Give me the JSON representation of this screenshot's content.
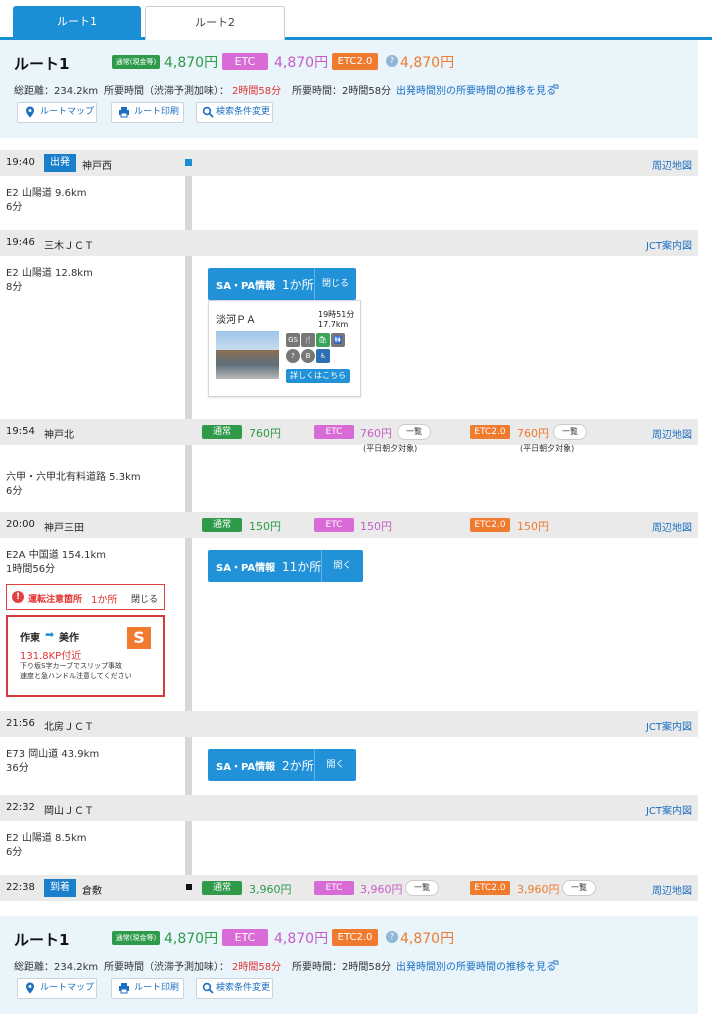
{
  "tabs": [
    {
      "label": "ルート1"
    },
    {
      "label": "ルート2"
    }
  ],
  "summary": {
    "title": "ルート1",
    "normal_badge": "通常(現金等)",
    "normal_price": "4,870円",
    "etc_badge": "ETC",
    "etc_price": "4,870円",
    "etc2_badge": "ETC2.0",
    "etc2_price": "4,870円",
    "info_icon": "?",
    "distance": "総距離：234.2km",
    "time_predicted_label": "所要時間（渋滞予測加味）：",
    "time_predicted": "2時間58分",
    "time_label": "所要時間：2時間58分",
    "trend_link": "出発時間別の所要時間の推移を見る",
    "buttons": {
      "map": "ルートマップ",
      "print": "ルート印刷",
      "search": "検索条件変更"
    }
  },
  "points": [
    {
      "time": "19:40",
      "name": "神戸西",
      "flag": "出発",
      "link": "周辺地図"
    },
    {
      "time": "19:46",
      "name": "三木ＪＣＴ",
      "link": "JCT案内図"
    },
    {
      "time": "19:54",
      "name": "神戸北",
      "link": "周辺地図"
    },
    {
      "time": "20:00",
      "name": "神戸三田",
      "link": "周辺地図"
    },
    {
      "time": "21:56",
      "name": "北房ＪＣＴ",
      "link": "JCT案内図"
    },
    {
      "time": "22:32",
      "name": "岡山ＪＣＴ",
      "link": "JCT案内図"
    },
    {
      "time": "22:38",
      "name": "倉敷",
      "flag": "到着",
      "link": "周辺地図"
    }
  ],
  "segments": [
    {
      "road": "E2 山陽道 9.6km",
      "time": "6分"
    },
    {
      "road": "E2 山陽道 12.8km",
      "time": "8分"
    },
    {
      "road": "六甲・六甲北有料道路 5.3km",
      "time": "6分"
    },
    {
      "road": "E2A 中国道 154.1km",
      "time": "1時間56分"
    },
    {
      "road": "E73 岡山道 43.9km",
      "time": "36分"
    },
    {
      "road": "E2 山陽道 8.5km",
      "time": "6分"
    }
  ],
  "fees": {
    "normal_label": "通常",
    "etc_label": "ETC",
    "etc2_label": "ETC2.0",
    "list_label": "一覧",
    "kobekita": {
      "normal": "760円",
      "etc": "760円",
      "etc2": "760円",
      "etc_note": "(平日朝夕対象)",
      "etc2_note": "(平日朝夕対象)"
    },
    "kobesanda": {
      "normal": "150円",
      "etc": "150円",
      "etc2": "150円"
    },
    "kurashiki": {
      "normal": "3,960円",
      "etc": "3,960円",
      "etc2": "3,960円"
    }
  },
  "sapa": {
    "label": "SA・PA情報",
    "one": {
      "count": "1か所",
      "action": "閉じる"
    },
    "eleven": {
      "count": "11か所",
      "action": "開く"
    },
    "two": {
      "count": "2か所",
      "action": "開く"
    }
  },
  "pa_card": {
    "name": "淡河ＰＡ",
    "time": "19時51分",
    "distance": "17.7km",
    "detail_button": "詳しくはこちら",
    "services": [
      "GS",
      "🍴",
      "🛍",
      "🚻",
      "?",
      "B",
      "♿"
    ]
  },
  "warning": {
    "label": "運転注意箇所",
    "count": "1か所",
    "close": "閉じる",
    "from": "作東",
    "to": "美作",
    "kp": "131.8KP付近",
    "line1": "下り坂S字カーブでスリップ事故",
    "line2": "速度と急ハンドル注意してください",
    "sign": "S"
  },
  "colors": {
    "accent": "#1a8fd6",
    "normal": "#2e9a4a",
    "etc": "#d86bd6",
    "etc2": "#f07a2e",
    "warn": "#e53333"
  }
}
